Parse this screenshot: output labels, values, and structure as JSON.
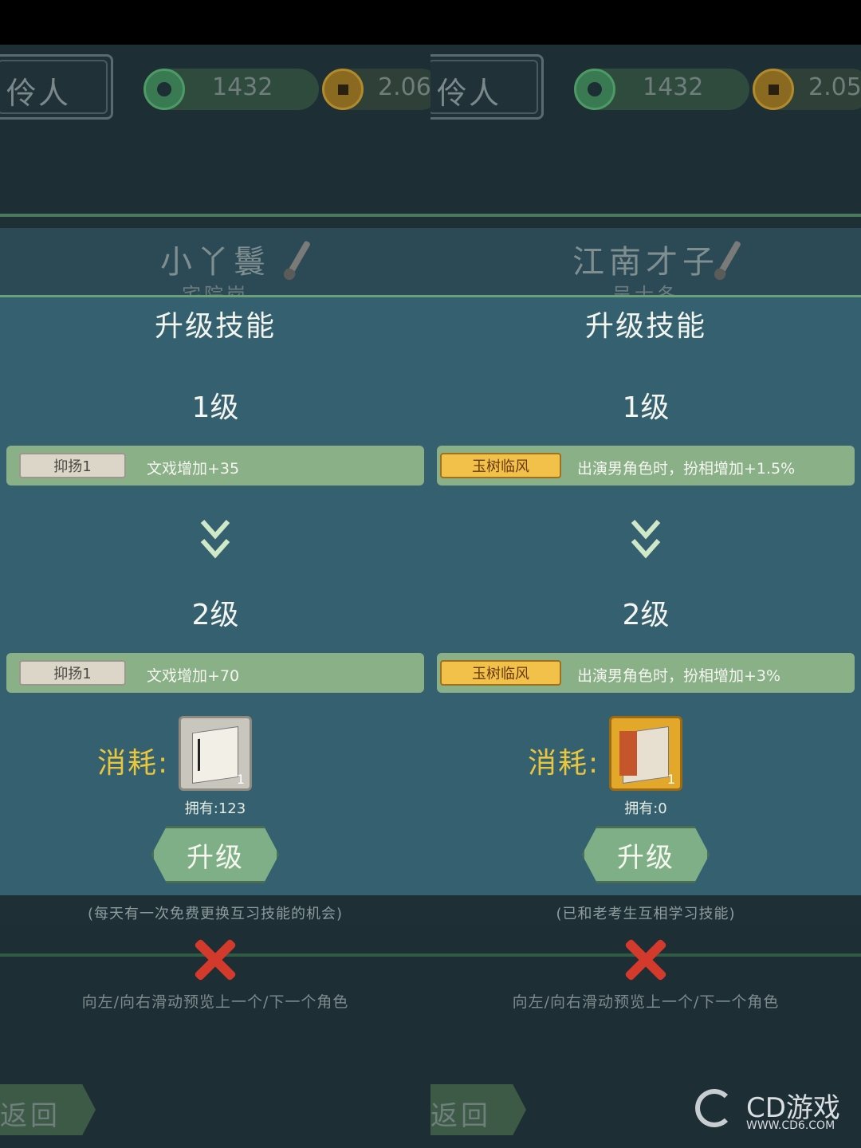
{
  "panels": [
    {
      "header": {
        "tag": "伶人",
        "jade": "1432",
        "coins": "2.06"
      },
      "character": {
        "name": "小丫鬟",
        "subtitle": "宅院岗"
      },
      "dialog": {
        "title": "升级技能",
        "level1": {
          "label": "1级",
          "skill": "抑扬1",
          "desc": "文戏增加+35",
          "badge_style": "silver"
        },
        "level2": {
          "label": "2级",
          "skill": "抑扬1",
          "desc": "文戏增加+70",
          "badge_style": "silver"
        },
        "cost_label": "消耗:",
        "item_count": "1",
        "owned": "拥有:123",
        "upgrade_button": "升级"
      },
      "note": "(每天有一次免费更换互习技能的机会)",
      "swipe_hint": "向左/向右滑动预览上一个/下一个角色",
      "back_button": "返回"
    },
    {
      "header": {
        "tag": "伶人",
        "jade": "1432",
        "coins": "2.05"
      },
      "character": {
        "name": "江南才子",
        "subtitle": "吴士冬"
      },
      "dialog": {
        "title": "升级技能",
        "level1": {
          "label": "1级",
          "skill": "玉树临风",
          "desc": "出演男角色时，扮相增加+1.5%",
          "badge_style": "gold"
        },
        "level2": {
          "label": "2级",
          "skill": "玉树临风",
          "desc": "出演男角色时，扮相增加+3%",
          "badge_style": "gold"
        },
        "cost_label": "消耗:",
        "item_count": "1",
        "owned": "拥有:0",
        "upgrade_button": "升级"
      },
      "note": "(已和老考生互相学习技能)",
      "swipe_hint": "向左/向右滑动预览上一个/下一个角色",
      "back_button": "返回"
    }
  ],
  "watermark": {
    "main": "CD游戏",
    "sub": "WWW.CD6.COM"
  },
  "colors": {
    "dialog_bg": "#35606f",
    "skill_bar": "#8ab088",
    "cost_label": "#e8c63e",
    "close_x": "#d43a2c"
  },
  "icons": [
    "jade-icon",
    "coin-icon",
    "brush-icon",
    "chevron-down-icon",
    "close-icon",
    "skill-item-icon"
  ]
}
